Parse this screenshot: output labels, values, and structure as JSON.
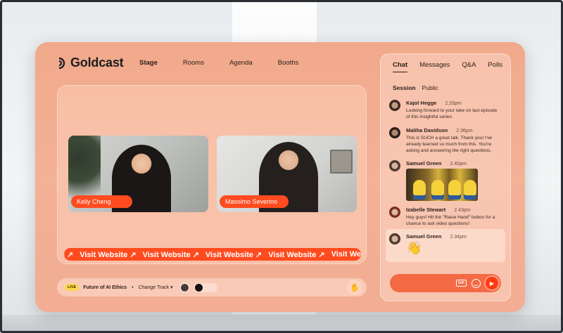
{
  "app": {
    "logo_text": "Goldcast"
  },
  "nav": {
    "items": [
      "Stage",
      "Rooms",
      "Agenda",
      "Booths"
    ],
    "active": "Stage"
  },
  "stage": {
    "participants": [
      {
        "name": "Kelly Cheng"
      },
      {
        "name": "Massimo Severino"
      }
    ],
    "ticker": {
      "items": [
        "site ↗",
        "Visit Website ↗",
        "Visit Website ↗",
        "Visit Website ↗",
        "Visit Website ↗",
        "Visit Website"
      ]
    }
  },
  "bottom_bar": {
    "live_badge": "LIVE",
    "session_title": "Future of AI Ethics",
    "separator": "•",
    "change_track": "Change Track ▾",
    "raise_hand_icon": "✋"
  },
  "chat": {
    "tabs": [
      "Chat",
      "Messages",
      "Q&A",
      "Polls"
    ],
    "active_tab": "Chat",
    "subtabs": [
      "Session",
      "Public"
    ],
    "active_subtab": "Session",
    "messages": [
      {
        "name": "Kajol Hegge",
        "time": "2.33pm",
        "text": "Looking forward to your take on last episode of this insightful series."
      },
      {
        "name": "Maliha Davidson",
        "time": "2.36pm",
        "text": "This is SUCH a great talk. Thank you! I've already learned so much from this. You're asking and answering the right questions."
      },
      {
        "name": "Samuel Green",
        "time": "2.40pm",
        "text": ""
      },
      {
        "name": "Izabelle Stewart",
        "time": "2.43pm",
        "text": "Hey guys! Hit the \"Raise Hand\" button for a chance to ask video questions!"
      },
      {
        "name": "Samuel Green",
        "time": "2.34pm",
        "text": "👋"
      }
    ],
    "input": {
      "gif_label": "GIF",
      "send_icon": "▶"
    }
  },
  "colors": {
    "accent": "#ff4b1f",
    "panel": "#f1a98b",
    "live": "#ffd84d"
  }
}
